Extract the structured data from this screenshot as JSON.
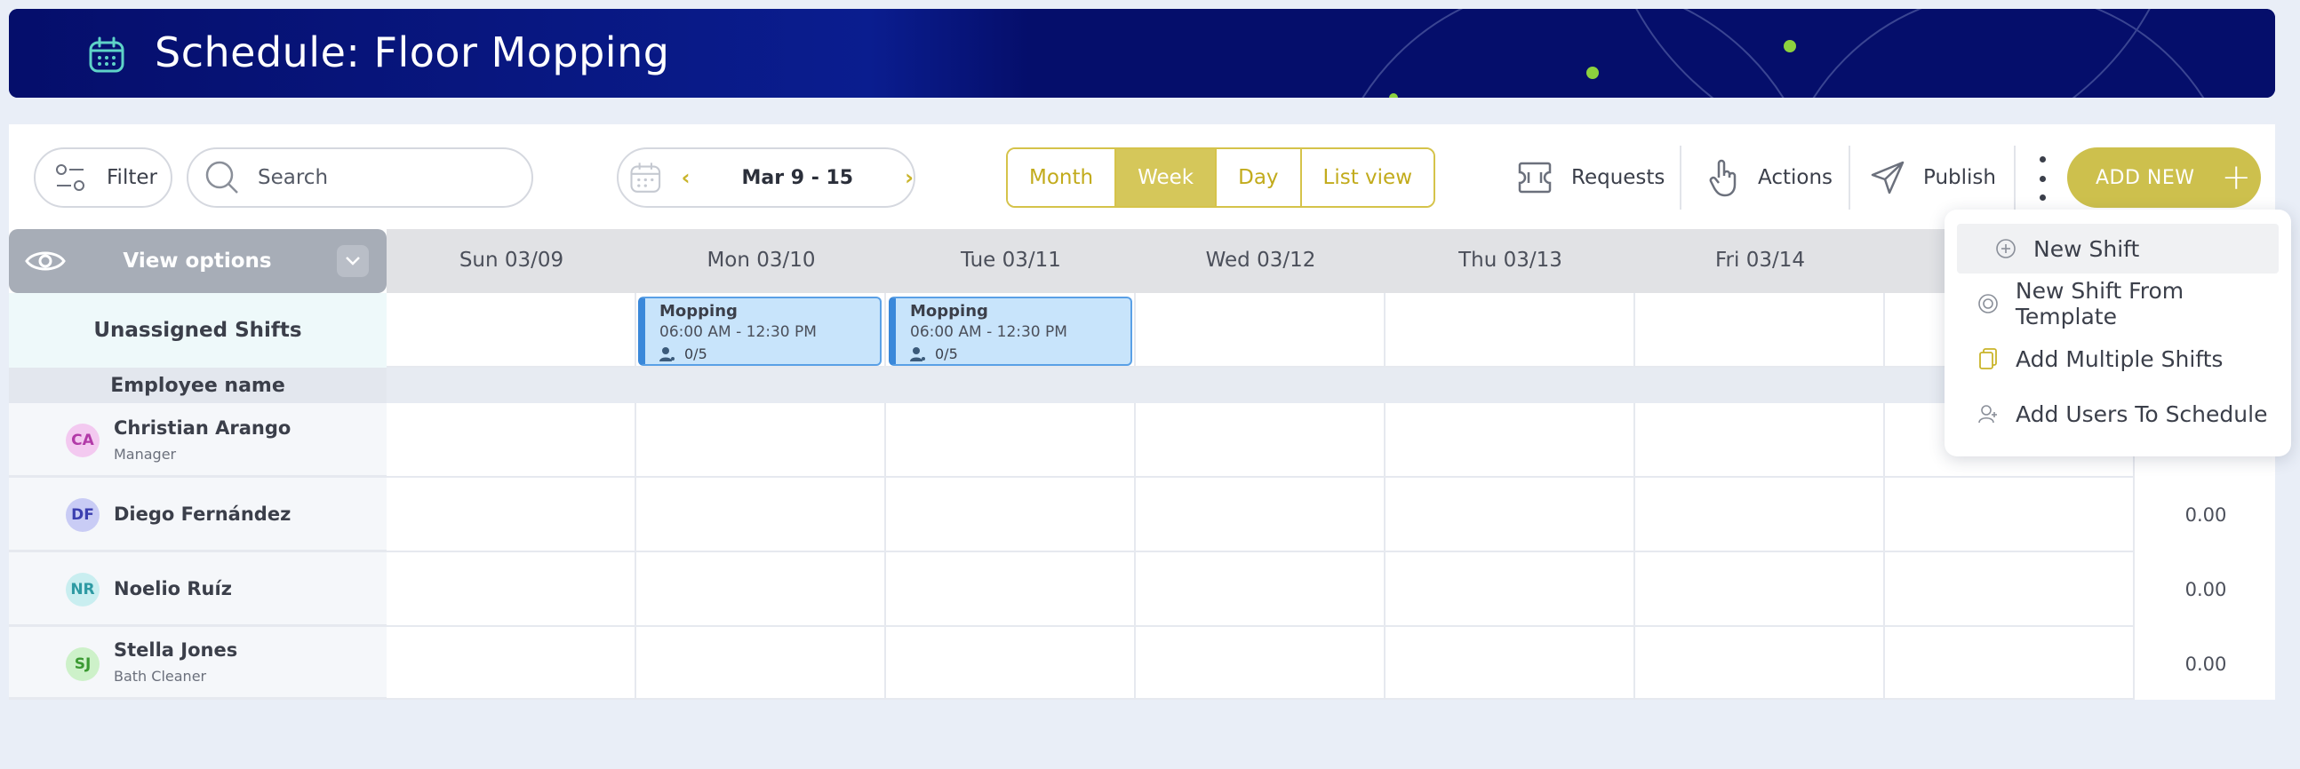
{
  "header": {
    "title": "Schedule: Floor Mopping"
  },
  "toolbar": {
    "filter_label": "Filter",
    "search_placeholder": "Search",
    "date_range": "Mar 9 - 15",
    "views": [
      "Month",
      "Week",
      "Day",
      "List view"
    ],
    "active_view": "Week",
    "requests_label": "Requests",
    "actions_label": "Actions",
    "publish_label": "Publish",
    "add_new_label": "ADD NEW"
  },
  "grid": {
    "view_options_label": "View options",
    "days": [
      "Sun 03/09",
      "Mon 03/10",
      "Tue 03/11",
      "Wed 03/12",
      "Thu 03/13",
      "Fri 03/14",
      ""
    ],
    "unassigned_label": "Unassigned Shifts",
    "employee_name_label": "Employee name",
    "shifts": [
      {
        "title": "Mopping",
        "time": "06:00 AM - 12:30 PM",
        "slots": "0/5"
      },
      {
        "title": "Mopping",
        "time": "06:00 AM - 12:30 PM",
        "slots": "0/5"
      }
    ],
    "employees": [
      {
        "initials": "CA",
        "name": "Christian Arango",
        "role": "Manager",
        "hours": "",
        "avatar_bg": "#f3c9f0",
        "avatar_fg": "#b23aa8"
      },
      {
        "initials": "DF",
        "name": "Diego Fernández",
        "role": "",
        "hours": "0.00",
        "avatar_bg": "#c9ccf5",
        "avatar_fg": "#3b3fb0"
      },
      {
        "initials": "NR",
        "name": "Noelio Ruíz",
        "role": "",
        "hours": "0.00",
        "avatar_bg": "#c9eef0",
        "avatar_fg": "#2e9aa3"
      },
      {
        "initials": "SJ",
        "name": "Stella Jones",
        "role": "Bath Cleaner",
        "hours": "0.00",
        "avatar_bg": "#cdf1c9",
        "avatar_fg": "#3b9a32"
      }
    ]
  },
  "dropdown": {
    "items": [
      "New Shift",
      "New Shift From Template",
      "Add Multiple Shifts",
      "Add Users To Schedule"
    ]
  },
  "colors": {
    "header_bg": "#050e6b",
    "accent": "#cdc04d",
    "shift_bg": "#c8e4fb"
  }
}
